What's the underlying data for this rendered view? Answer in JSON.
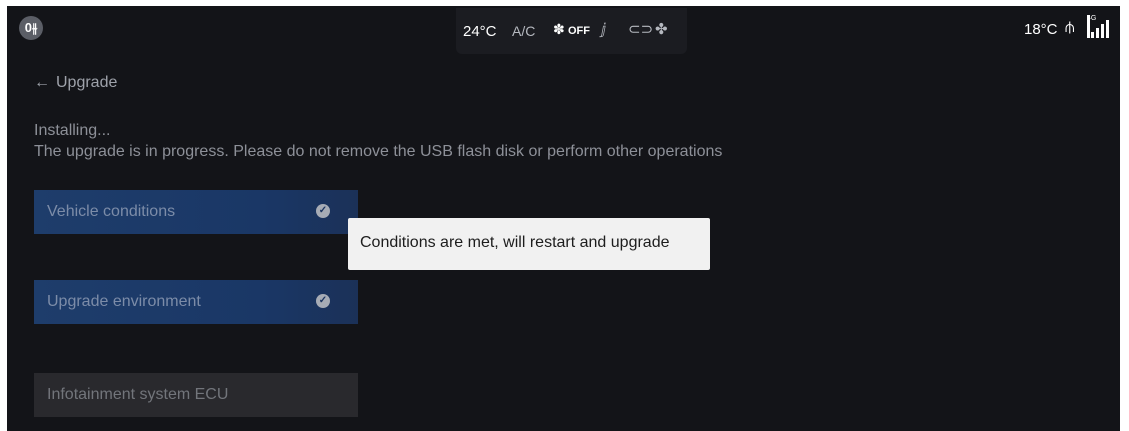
{
  "status_bar": {
    "left_icon": "fog-light-icon",
    "climate": {
      "temperature": "24°C",
      "ac": "A/C",
      "fan_icon": "fan-icon",
      "fan_state": "OFF",
      "icons": [
        "seat-airflow-icon",
        "car-recirculation-icon",
        "fan-speed-icon"
      ]
    },
    "outside_temperature": "18°C",
    "usb_icon": "usb-icon",
    "network": "4G",
    "signal_icon": "signal-bars-icon"
  },
  "header": {
    "back_arrow": "←",
    "title": "Upgrade"
  },
  "status": {
    "title": "Installing...",
    "description": "The upgrade is in progress. Please do not remove the USB flash disk or perform other operations"
  },
  "steps": [
    {
      "label": "Vehicle conditions",
      "state": "done"
    },
    {
      "label": "Upgrade environment",
      "state": "done"
    },
    {
      "label": "Infotainment system ECU",
      "state": "pending"
    }
  ],
  "toast": {
    "message": "Conditions are met, will restart and upgrade"
  },
  "colors": {
    "background": "#131418",
    "step_done": "#1e3d6b",
    "step_pending": "#29292d",
    "toast_bg": "#f1f1f1"
  }
}
